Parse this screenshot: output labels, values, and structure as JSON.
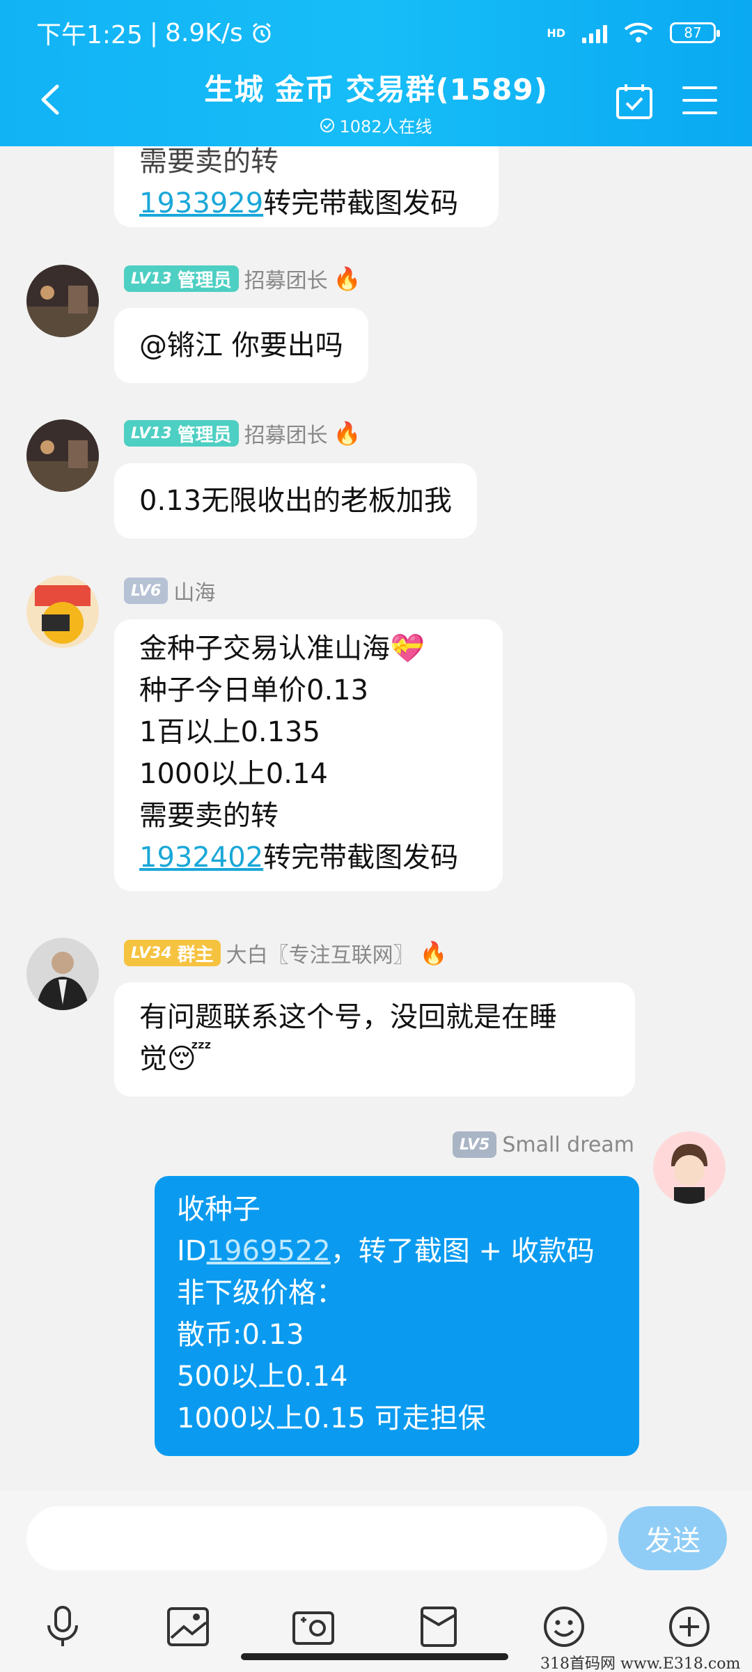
{
  "status_bar": {
    "time": "下午1:25",
    "net_speed": "8.9K/s",
    "hd": "HD",
    "battery": "87"
  },
  "header": {
    "title": "生城 金币 交易群(1589)",
    "online": "1082人在线"
  },
  "messages": {
    "m0": {
      "line1": "需要卖的转",
      "link": "1933929",
      "rest": "转完带截图发码"
    },
    "m1": {
      "level": "LV13",
      "role": "管理员",
      "name": "招募团长",
      "text": "@锵江 你要出吗"
    },
    "m2": {
      "level": "LV13",
      "role": "管理员",
      "name": "招募团长",
      "text": "0.13无限收出的老板加我"
    },
    "m3": {
      "level": "LV6",
      "name": "山海",
      "l1": "金种子交易认准山海💝",
      "l2": "种子今日单价0.13",
      "l3": "1百以上0.135",
      "l4": "1000以上0.14",
      "l5": "需要卖的转",
      "link": "1932402",
      "l6": "转完带截图发码"
    },
    "m4": {
      "level": "LV34",
      "role": "群主",
      "name": "大白〖专注互联网〗",
      "l1": "有问题联系这个号，没回就是在睡",
      "l2": "觉😴"
    },
    "m5": {
      "level": "LV5",
      "name": "Small dream",
      "l1": "收种子",
      "id_prefix": "ID",
      "link": "1969522",
      "id_rest": "，转了截图 + 收款码",
      "l3": "非下级价格：",
      "l4": "散币:0.13",
      "l5": "500以上0.14",
      "l6": "1000以上0.15   可走担保"
    }
  },
  "input_bar": {
    "send_label": "发送"
  },
  "watermark": "318首码网 www.E318.com",
  "icons": [
    "back-arrow-icon",
    "calendar-check-icon",
    "menu-icon",
    "microphone-icon",
    "image-icon",
    "camera-icon",
    "red-packet-icon",
    "emoji-icon",
    "plus-icon",
    "fire-icon",
    "alarm-icon",
    "wifi-icon"
  ]
}
